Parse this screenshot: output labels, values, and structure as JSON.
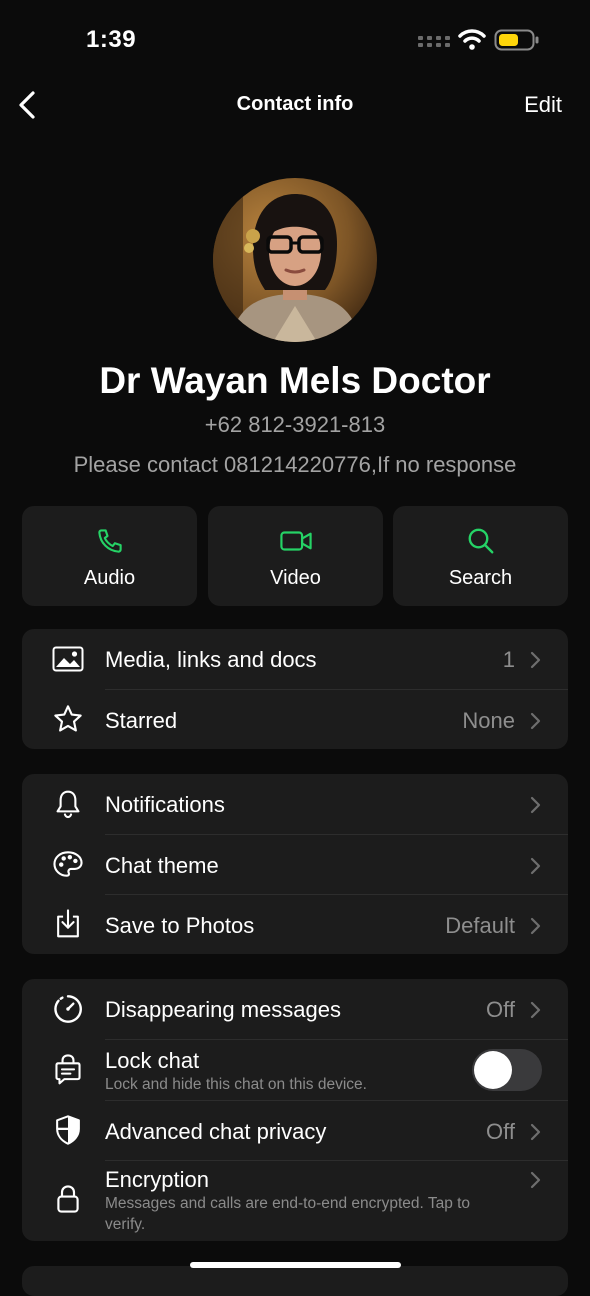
{
  "status_bar": {
    "time": "1:39",
    "battery_color": "#FFD60A"
  },
  "nav": {
    "back_icon": "chevron-left-icon",
    "title": "Contact info",
    "edit_label": "Edit"
  },
  "profile": {
    "name": "Dr Wayan Mels Doctor",
    "phone": "+62 812-3921-813",
    "about": "Please contact 081214220776,If no response"
  },
  "actions": [
    {
      "label": "Audio",
      "icon": "phone-icon"
    },
    {
      "label": "Video",
      "icon": "video-icon"
    },
    {
      "label": "Search",
      "icon": "search-icon"
    }
  ],
  "accent_color": "#25D366",
  "group1": [
    {
      "label": "Media, links and docs",
      "value": "1",
      "icon": "media-icon"
    },
    {
      "label": "Starred",
      "value": "None",
      "icon": "star-icon"
    }
  ],
  "group2": [
    {
      "label": "Notifications",
      "value": "",
      "icon": "bell-icon"
    },
    {
      "label": "Chat theme",
      "value": "",
      "icon": "palette-icon"
    },
    {
      "label": "Save to Photos",
      "value": "Default",
      "icon": "save-icon"
    }
  ],
  "group3": {
    "disappearing": {
      "label": "Disappearing messages",
      "value": "Off",
      "icon": "timer-icon"
    },
    "lock_chat": {
      "label": "Lock chat",
      "subtitle": "Lock and hide this chat on this device.",
      "toggle_on": false,
      "icon": "lock-chat-icon"
    },
    "advanced_privacy": {
      "label": "Advanced chat privacy",
      "value": "Off",
      "icon": "shield-icon"
    },
    "encryption": {
      "label": "Encryption",
      "subtitle": "Messages and calls are end-to-end encrypted. Tap to verify.",
      "icon": "lock-icon"
    }
  }
}
